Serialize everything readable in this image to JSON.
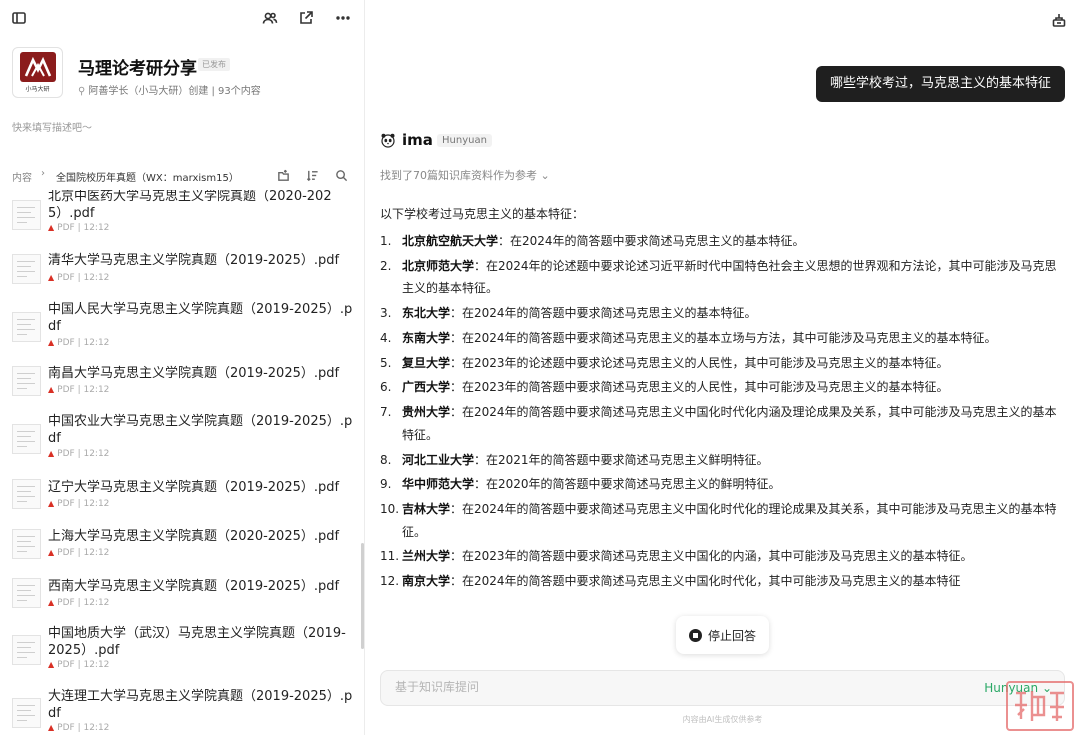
{
  "kb": {
    "title": "马理论考研分享",
    "badge": "已发布",
    "meta": "阿善学长（小马大研）创建 | 93个内容",
    "logo_caption": "小马大研",
    "description_placeholder": "快来填写描述吧～"
  },
  "path": {
    "root": "内容",
    "current": "全国院校历年真题（WX：marxism15）"
  },
  "files": [
    {
      "name": "北京中医药大学马克思主义学院真题（2020-2025）.pdf",
      "type": "PDF",
      "time": "12:12"
    },
    {
      "name": "清华大学马克思主义学院真题（2019-2025）.pdf",
      "type": "PDF",
      "time": "12:12"
    },
    {
      "name": "中国人民大学马克思主义学院真题（2019-2025）.pdf",
      "type": "PDF",
      "time": "12:12"
    },
    {
      "name": "南昌大学马克思主义学院真题（2019-2025）.pdf",
      "type": "PDF",
      "time": "12:12"
    },
    {
      "name": "中国农业大学马克思主义学院真题（2019-2025）.pdf",
      "type": "PDF",
      "time": "12:12"
    },
    {
      "name": "辽宁大学马克思主义学院真题（2019-2025）.pdf",
      "type": "PDF",
      "time": "12:12"
    },
    {
      "name": "上海大学马克思主义学院真题（2020-2025）.pdf",
      "type": "PDF",
      "time": "12:12"
    },
    {
      "name": "西南大学马克思主义学院真题（2019-2025）.pdf",
      "type": "PDF",
      "time": "12:12"
    },
    {
      "name": "中国地质大学（武汉）马克思主义学院真题（2019-2025）.pdf",
      "type": "PDF",
      "time": "12:12"
    },
    {
      "name": "大连理工大学马克思主义学院真题（2019-2025）.pdf",
      "type": "PDF",
      "time": "12:12"
    }
  ],
  "chat": {
    "question": "哪些学校考过，马克思主义的基本特征",
    "bot_name": "ima",
    "model_tag": "Hunyuan",
    "refs": "找到了70篇知识库资料作为参考",
    "intro": "以下学校考过马克思主义的基本特征：",
    "answers": [
      {
        "num": "1.",
        "school": "北京航空航天大学",
        "text": "：在2024年的简答题中要求简述马克思主义的基本特征。"
      },
      {
        "num": "2.",
        "school": "北京师范大学",
        "text": "：在2024年的论述题中要求论述习近平新时代中国特色社会主义思想的世界观和方法论，其中可能涉及马克思主义的基本特征。"
      },
      {
        "num": "3.",
        "school": "东北大学",
        "text": "：在2024年的简答题中要求简述马克思主义的基本特征。"
      },
      {
        "num": "4.",
        "school": "东南大学",
        "text": "：在2024年的简答题中要求简述马克思主义的基本立场与方法，其中可能涉及马克思主义的基本特征。"
      },
      {
        "num": "5.",
        "school": "复旦大学",
        "text": "：在2023年的论述题中要求论述马克思主义的人民性，其中可能涉及马克思主义的基本特征。"
      },
      {
        "num": "6.",
        "school": "广西大学",
        "text": "：在2023年的简答题中要求简述马克思主义的人民性，其中可能涉及马克思主义的基本特征。"
      },
      {
        "num": "7.",
        "school": "贵州大学",
        "text": "：在2024年的简答题中要求简述马克思主义中国化时代化内涵及理论成果及关系，其中可能涉及马克思主义的基本特征。"
      },
      {
        "num": "8.",
        "school": "河北工业大学",
        "text": "：在2021年的简答题中要求简述马克思主义鲜明特征。"
      },
      {
        "num": "9.",
        "school": "华中师范大学",
        "text": "：在2020年的简答题中要求简述马克思主义的鲜明特征。"
      },
      {
        "num": "10.",
        "school": "吉林大学",
        "text": "：在2024年的简答题中要求简述马克思主义中国化时代化的理论成果及其关系，其中可能涉及马克思主义的基本特征。"
      },
      {
        "num": "11.",
        "school": "兰州大学",
        "text": "：在2023年的简答题中要求简述马克思主义中国化的内涵，其中可能涉及马克思主义的基本特征。"
      },
      {
        "num": "12.",
        "school": "南京大学",
        "text": "：在2024年的简答题中要求简述马克思主义中国化时代化，其中可能涉及马克思主义的基本特征"
      }
    ],
    "stop_label": "停止回答",
    "input_placeholder": "基于知识库提问",
    "model_select": "Hunyuan",
    "disclaimer": "内容由AI生成仅供参考"
  },
  "colors": {
    "accent_green": "#2aa866",
    "logo_red": "#8b1c1c",
    "pdf_red": "#d93025"
  },
  "icons": [
    "sidebar-toggle-icon",
    "members-icon",
    "share-icon",
    "more-icon",
    "add-folder-icon",
    "sort-icon",
    "search-icon",
    "export-icon",
    "pdf-icon",
    "chevron-down-icon",
    "stop-icon"
  ]
}
